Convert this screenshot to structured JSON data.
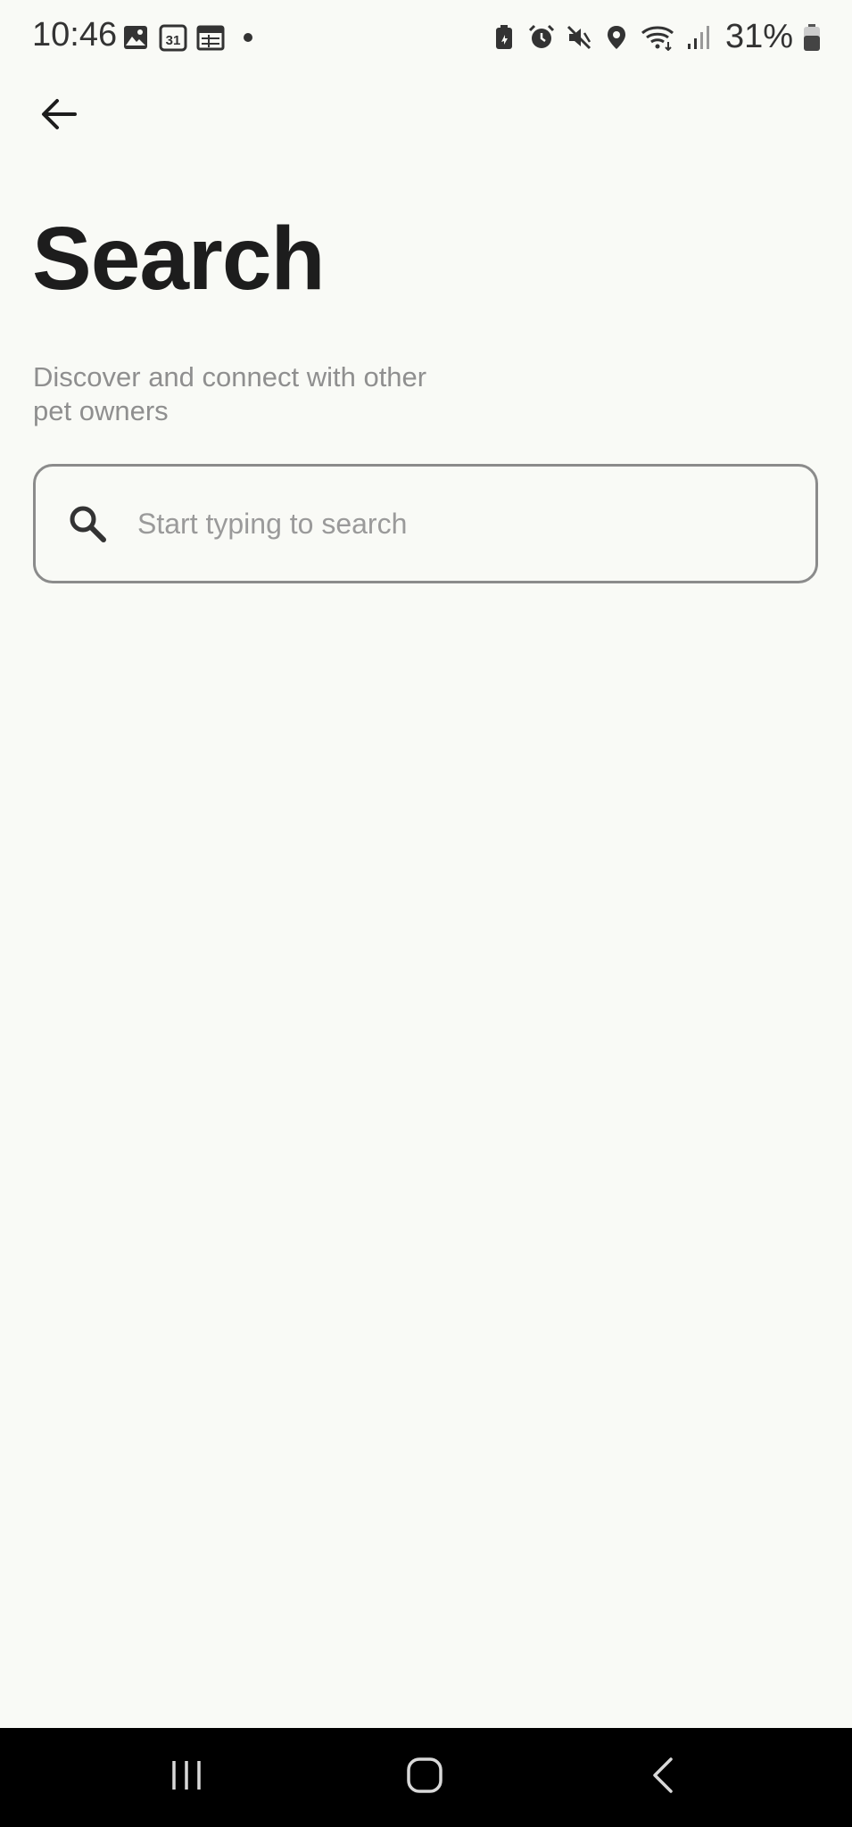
{
  "status_bar": {
    "time": "10:46",
    "battery": "31%",
    "left_icons": [
      "gallery-icon",
      "calendar-31-icon",
      "calendar-icon",
      "dot-icon"
    ],
    "right_icons": [
      "battery-saver-icon",
      "alarm-icon",
      "mute-icon",
      "location-icon",
      "wifi-icon",
      "signal-icon",
      "battery-icon"
    ]
  },
  "header": {
    "back_icon": "arrow-left-icon",
    "title": "Search",
    "subtitle": "Discover and connect with other pet owners"
  },
  "search": {
    "icon": "search-icon",
    "placeholder": "Start typing to search",
    "value": ""
  },
  "nav_bar": {
    "buttons": [
      "recents-icon",
      "home-icon",
      "back-icon"
    ]
  },
  "colors": {
    "background": "#f9faf6",
    "title": "#1d1d1d",
    "subtitle": "#8f8f8f",
    "field_border": "#8b8b8b",
    "nav_background": "#000000"
  }
}
